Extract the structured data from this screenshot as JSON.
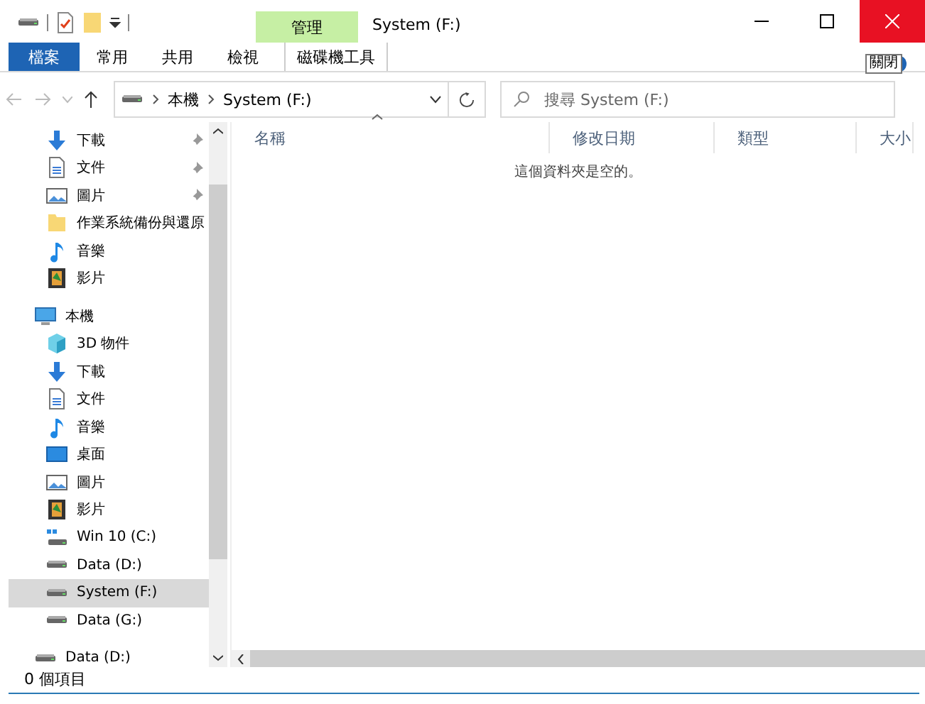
{
  "title_bar": {
    "context_group": "管理",
    "title": "System (F:)"
  },
  "ribbon": {
    "tabs": [
      {
        "label": "檔案",
        "kind": "file"
      },
      {
        "label": "常用",
        "kind": "normal"
      },
      {
        "label": "共用",
        "kind": "normal"
      },
      {
        "label": "檢視",
        "kind": "normal"
      },
      {
        "label": "磁碟機工具",
        "kind": "context"
      }
    ]
  },
  "tooltip": "關閉",
  "address_bar": {
    "path": [
      "本機",
      "System (F:)"
    ]
  },
  "search": {
    "placeholder": "搜尋 System (F:)"
  },
  "sidebar": {
    "items": [
      {
        "label": "下載",
        "kind": "download",
        "pinned": true,
        "selected": false
      },
      {
        "label": "文件",
        "kind": "document",
        "pinned": true,
        "selected": false
      },
      {
        "label": "圖片",
        "kind": "pictures",
        "pinned": true,
        "selected": false
      },
      {
        "label": "作業系統備份與還原",
        "kind": "folder",
        "pinned": false,
        "selected": false
      },
      {
        "label": "音樂",
        "kind": "music",
        "pinned": false,
        "selected": false
      },
      {
        "label": "影片",
        "kind": "video",
        "pinned": false,
        "selected": false
      },
      {
        "label": "本機",
        "kind": "computer",
        "pinned": false,
        "selected": false,
        "children": [
          {
            "label": "3D 物件",
            "kind": "cube",
            "pinned": false,
            "selected": false
          },
          {
            "label": "下載",
            "kind": "download",
            "pinned": false,
            "selected": false
          },
          {
            "label": "文件",
            "kind": "document",
            "pinned": false,
            "selected": false
          },
          {
            "label": "音樂",
            "kind": "music",
            "pinned": false,
            "selected": false
          },
          {
            "label": "桌面",
            "kind": "desktop",
            "pinned": false,
            "selected": false
          },
          {
            "label": "圖片",
            "kind": "pictures",
            "pinned": false,
            "selected": false
          },
          {
            "label": "影片",
            "kind": "video",
            "pinned": false,
            "selected": false
          },
          {
            "label": "Win 10 (C:)",
            "kind": "windrive",
            "pinned": false,
            "selected": false
          },
          {
            "label": "Data (D:)",
            "kind": "drive",
            "pinned": false,
            "selected": false
          },
          {
            "label": "System (F:)",
            "kind": "drive",
            "pinned": false,
            "selected": true
          },
          {
            "label": "Data (G:)",
            "kind": "drive",
            "pinned": false,
            "selected": false
          }
        ]
      },
      {
        "label": "Data (D:)",
        "kind": "drive",
        "pinned": false,
        "selected": false
      }
    ]
  },
  "table": {
    "columns": [
      {
        "label": "名稱",
        "sorted": true
      },
      {
        "label": "修改日期",
        "sorted": false
      },
      {
        "label": "類型",
        "sorted": false
      },
      {
        "label": "大小",
        "sorted": false
      }
    ],
    "empty_message": "這個資料夾是空的。"
  },
  "status_bar": {
    "item_count": "0 個項目"
  }
}
